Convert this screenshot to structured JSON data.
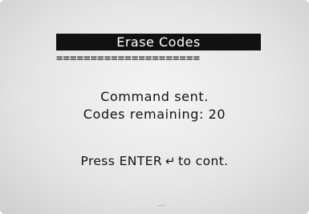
{
  "screen": {
    "title": "Erase Codes",
    "separator": "=====================",
    "status_line": "Command sent.",
    "remaining_line": "Codes remaining: 20",
    "prompt_before": "Press ENTER",
    "enter_icon": "↵",
    "prompt_after": "to cont."
  }
}
